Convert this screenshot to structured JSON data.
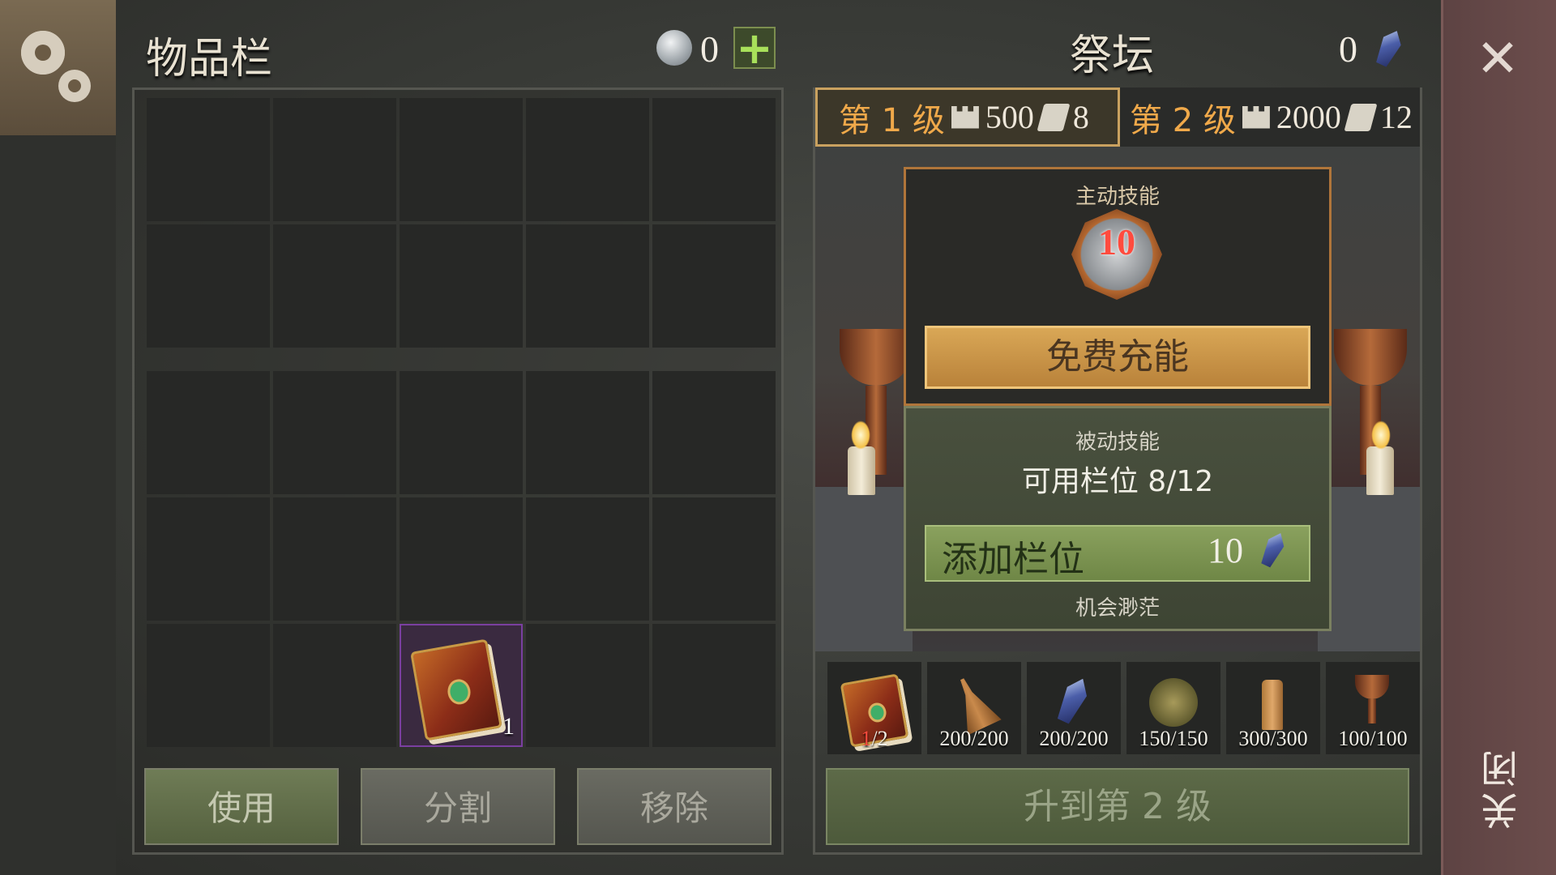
{
  "inventory": {
    "title": "物品栏",
    "silver_count": "0",
    "add_label": "+",
    "book_quantity": "1",
    "buttons": {
      "use": "使用",
      "split": "分割",
      "remove": "移除"
    }
  },
  "altar": {
    "title": "祭坛",
    "crystal_count": "0",
    "tabs": [
      {
        "level": "第 1 级",
        "castle": "500",
        "scrolls": "8"
      },
      {
        "level": "第 2 级",
        "castle": "2000",
        "scrolls": "12"
      }
    ],
    "active_skill": {
      "label": "主动技能",
      "level": "10",
      "button": "免费充能"
    },
    "passive_skill": {
      "label": "被动技能",
      "slots": "可用栏位 8/12",
      "add_button": "添加栏位",
      "add_cost": "10",
      "chance": "机会渺茫"
    },
    "requirements": [
      {
        "icon": "book-icon",
        "have": "1",
        "need": "/2"
      },
      {
        "icon": "bell-icon",
        "value": "200/200"
      },
      {
        "icon": "crystal-icon",
        "value": "200/200"
      },
      {
        "icon": "herb-ball-icon",
        "value": "150/150"
      },
      {
        "icon": "candle-icon",
        "value": "300/300"
      },
      {
        "icon": "goblet-icon",
        "value": "100/100"
      }
    ],
    "upgrade_button": "升到第 2 级"
  },
  "close": {
    "label": "关闭",
    "icon_glyph": "✕"
  }
}
